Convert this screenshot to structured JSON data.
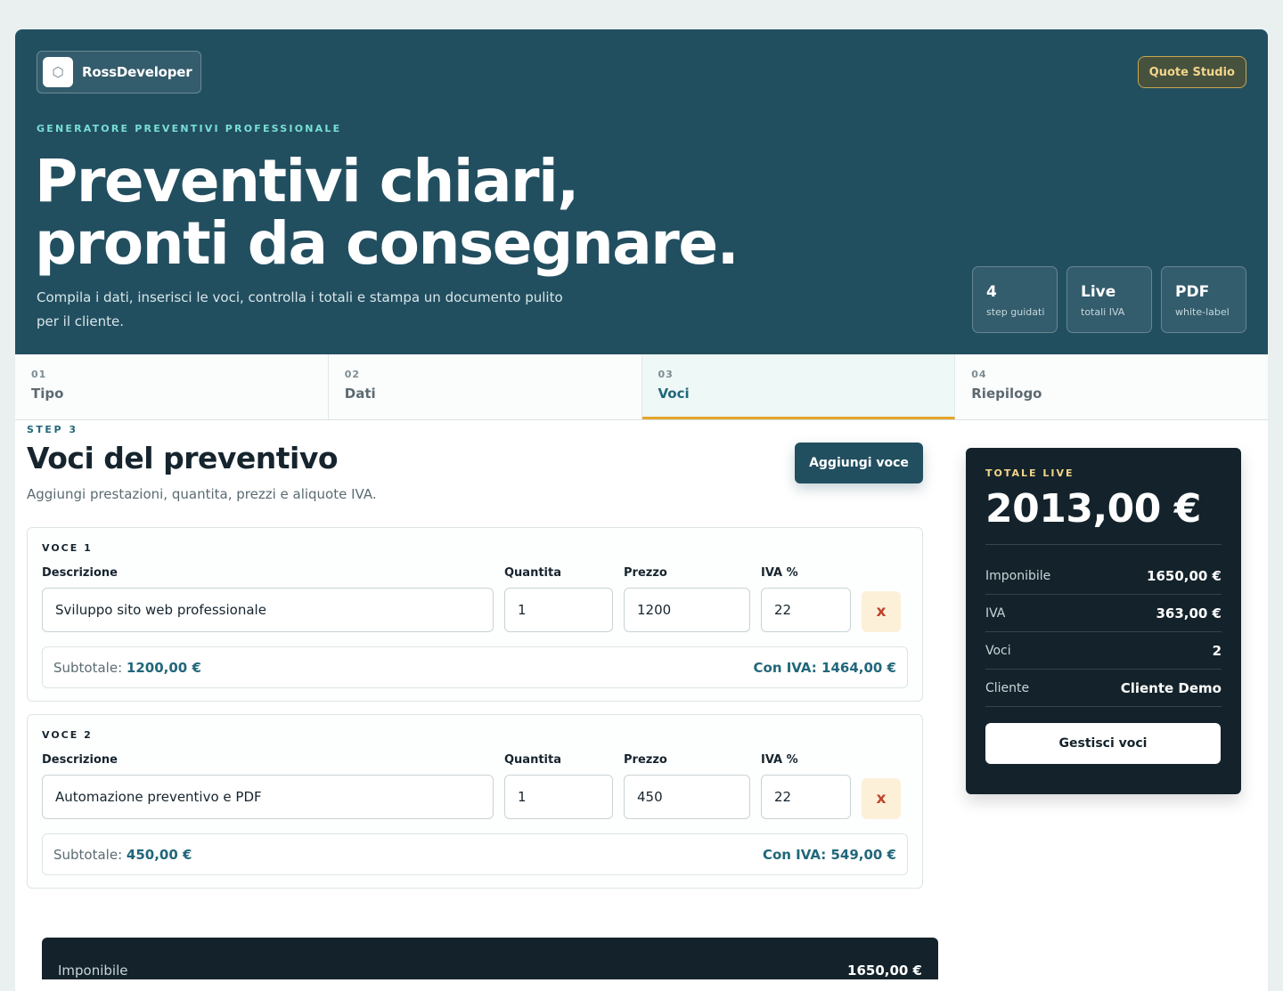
{
  "brand": {
    "name": "RossDeveloper",
    "logo_icon": "hexagon-logo-icon"
  },
  "header": {
    "pill": "Quote Studio",
    "eyebrow": "GENERATORE PREVENTIVI PROFESSIONALE",
    "title_line1": "Preventivi chiari,",
    "title_line2": "pronti da consegnare.",
    "lead": "Compila i dati, inserisci le voci, controlla i totali e stampa un documento pulito per il cliente.",
    "stats": [
      {
        "value": "4",
        "label": "step guidati"
      },
      {
        "value": "Live",
        "label": "totali IVA"
      },
      {
        "value": "PDF",
        "label": "white-label"
      }
    ]
  },
  "steps": [
    {
      "num": "01",
      "label": "Tipo"
    },
    {
      "num": "02",
      "label": "Dati"
    },
    {
      "num": "03",
      "label": "Voci"
    },
    {
      "num": "04",
      "label": "Riepilogo"
    }
  ],
  "active_step": 2,
  "section": {
    "eyebrow": "STEP 3",
    "title": "Voci del preventivo",
    "subtitle": "Aggiungi prestazioni, quantita, prezzi e aliquote IVA.",
    "add_button": "Aggiungi voce"
  },
  "field_labels": {
    "descrizione": "Descrizione",
    "quantita": "Quantita",
    "prezzo": "Prezzo",
    "iva": "IVA %"
  },
  "voci": [
    {
      "title": "VOCE 1",
      "descrizione": "Sviluppo sito web professionale",
      "quantita": "1",
      "prezzo": "1200",
      "iva": "22",
      "delete_label": "x",
      "subtotale_label": "Subtotale:",
      "subtotale": "1200,00 €",
      "con_iva": "Con IVA: 1464,00 €"
    },
    {
      "title": "VOCE 2",
      "descrizione": "Automazione preventivo e PDF",
      "quantita": "1",
      "prezzo": "450",
      "iva": "22",
      "delete_label": "x",
      "subtotale_label": "Subtotale:",
      "subtotale": "450,00 €",
      "con_iva": "Con IVA: 549,00 €"
    }
  ],
  "bottom": {
    "label": "Imponibile",
    "value": "1650,00 €"
  },
  "sidebar": {
    "eyebrow": "TOTALE LIVE",
    "total": "2013,00 €",
    "rows": [
      {
        "label": "Imponibile",
        "value": "1650,00 €"
      },
      {
        "label": "IVA",
        "value": "363,00 €"
      },
      {
        "label": "Voci",
        "value": "2"
      },
      {
        "label": "Cliente",
        "value": "Cliente Demo"
      }
    ],
    "button": "Gestisci voci"
  },
  "colors": {
    "hero": "#224f60",
    "accent": "#e4a42b",
    "dark_panel": "#14232b",
    "teal_text": "#21677a"
  }
}
